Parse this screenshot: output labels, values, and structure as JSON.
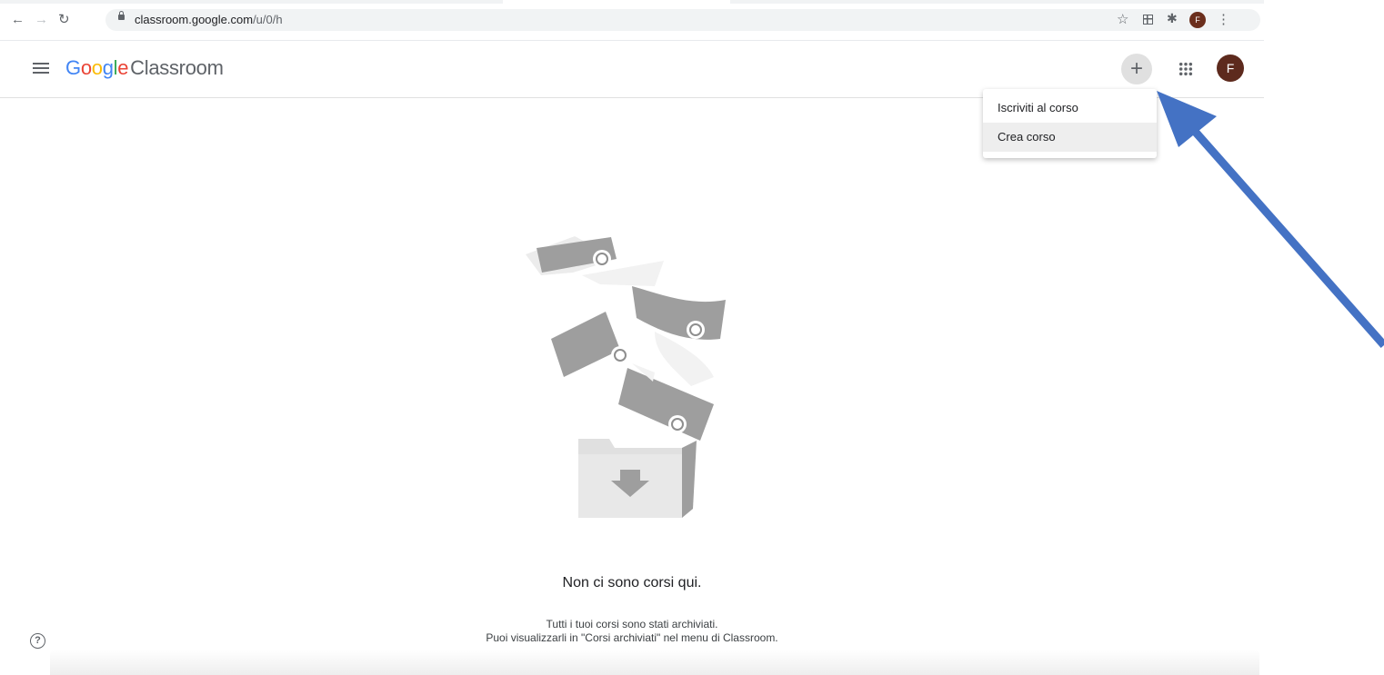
{
  "browser": {
    "url_host": "classroom.google.com",
    "url_path": "/u/0/h",
    "icons": [
      "back-arrow-icon",
      "forward-arrow-icon",
      "reload-icon",
      "lock-icon",
      "star-icon",
      "extension-grid-icon",
      "puzzle-icon",
      "profile-avatar",
      "kebab-menu-icon"
    ],
    "profile_initial": "F"
  },
  "header": {
    "logo_google": [
      "G",
      "o",
      "o",
      "g",
      "l",
      "e"
    ],
    "logo_product": "Classroom",
    "plus_label": "+",
    "avatar_initial": "F",
    "avatar_color": "#5d2a1d"
  },
  "menu": {
    "items": [
      {
        "label": "Iscriviti al corso"
      },
      {
        "label": "Crea corso"
      }
    ]
  },
  "empty_state": {
    "title": "Non ci sono corsi qui.",
    "line1": "Tutti i tuoi corsi sono stati archiviati.",
    "line2": "Puoi visualizzarli in \"Corsi archiviati\" nel menu di Classroom."
  },
  "help_icon_glyph": "?",
  "annotation": {
    "arrow_color": "#4472c4",
    "points_to": "plus-button"
  }
}
